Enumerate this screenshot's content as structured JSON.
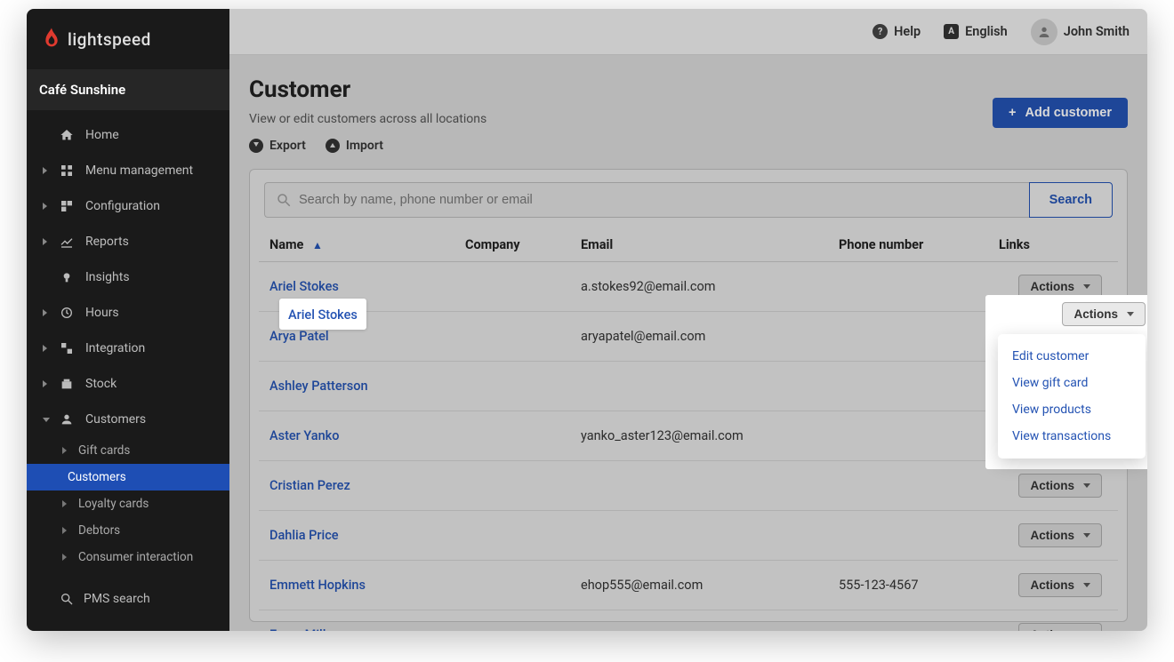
{
  "brand": "lightspeed",
  "tenant": "Café Sunshine",
  "sidebar": {
    "items": [
      {
        "label": "Home",
        "icon": "home",
        "expandable": false
      },
      {
        "label": "Menu management",
        "icon": "menu",
        "expandable": true
      },
      {
        "label": "Configuration",
        "icon": "config",
        "expandable": true
      },
      {
        "label": "Reports",
        "icon": "reports",
        "expandable": true
      },
      {
        "label": "Insights",
        "icon": "insights",
        "expandable": false
      },
      {
        "label": "Hours",
        "icon": "hours",
        "expandable": true
      },
      {
        "label": "Integration",
        "icon": "integration",
        "expandable": true
      },
      {
        "label": "Stock",
        "icon": "stock",
        "expandable": true
      },
      {
        "label": "Customers",
        "icon": "customers",
        "expandable": true,
        "open": true,
        "children": [
          {
            "label": "Gift cards",
            "expandable": true
          },
          {
            "label": "Customers",
            "active": true
          },
          {
            "label": "Loyalty cards",
            "expandable": true
          },
          {
            "label": "Debtors",
            "expandable": true
          },
          {
            "label": "Consumer interaction",
            "expandable": true
          }
        ]
      }
    ],
    "bottom_label": "PMS search"
  },
  "topbar": {
    "help": "Help",
    "language": "English",
    "user": "John Smith"
  },
  "page": {
    "title": "Customer",
    "subtitle": "View or edit customers across all locations",
    "add_button": "Add customer",
    "export": "Export",
    "import": "Import"
  },
  "search": {
    "placeholder": "Search by name, phone number or email",
    "button": "Search"
  },
  "table": {
    "columns": {
      "name": "Name",
      "company": "Company",
      "email": "Email",
      "phone": "Phone number",
      "links": "Links"
    },
    "sort_column": "name",
    "sort_dir": "asc",
    "rows": [
      {
        "name": "Ariel Stokes",
        "company": "",
        "email": "a.stokes92@email.com",
        "phone": ""
      },
      {
        "name": "Arya Patel",
        "company": "",
        "email": "aryapatel@email.com",
        "phone": ""
      },
      {
        "name": "Ashley Patterson",
        "company": "",
        "email": "",
        "phone": ""
      },
      {
        "name": "Aster Yanko",
        "company": "",
        "email": "yanko_aster123@email.com",
        "phone": ""
      },
      {
        "name": "Cristian Perez",
        "company": "",
        "email": "",
        "phone": ""
      },
      {
        "name": "Dahlia Price",
        "company": "",
        "email": "",
        "phone": ""
      },
      {
        "name": "Emmett Hopkins",
        "company": "",
        "email": "ehop555@email.com",
        "phone": "555-123-4567"
      },
      {
        "name": "Esme Miller",
        "company": "",
        "email": "",
        "phone": ""
      }
    ],
    "actions_label": "Actions"
  },
  "actions_menu": [
    "Edit customer",
    "View gift card",
    "View products",
    "View transactions"
  ]
}
